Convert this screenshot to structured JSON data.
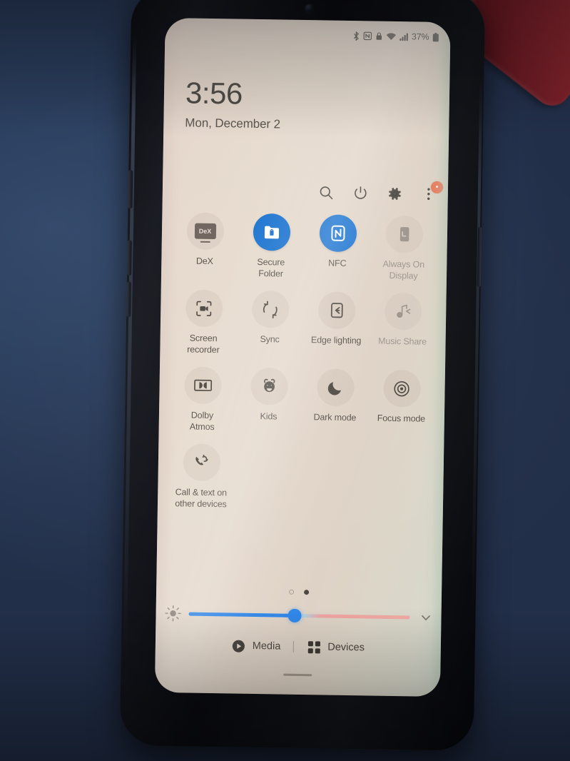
{
  "photo": {
    "background_color": "#22304a",
    "red_object_color": "#7c2028",
    "phone_body_color": "#0c0d12"
  },
  "screen": {
    "background_color": "#e3d4c9",
    "accent_color": "#1a73d0",
    "slider_color": "#2d85e8",
    "badge_color": "#ec6a4a"
  },
  "status_bar": {
    "icons": [
      {
        "name": "bluetooth-icon",
        "glyph": "✶"
      },
      {
        "name": "nfc-icon",
        "glyph": "N"
      },
      {
        "name": "lock-icon",
        "glyph": "▣"
      },
      {
        "name": "wifi-icon",
        "glyph": "◠"
      },
      {
        "name": "signal-icon",
        "glyph": "▂"
      }
    ],
    "battery_percent": "37%"
  },
  "clock": {
    "time": "3:56",
    "date": "Mon, December 2"
  },
  "header_actions": [
    {
      "name": "search-icon",
      "label": "Search"
    },
    {
      "name": "power-icon",
      "label": "Power off"
    },
    {
      "name": "gear-icon",
      "label": "Settings"
    },
    {
      "name": "more-options-icon",
      "label": "More options",
      "badge": "•"
    }
  ],
  "tiles": [
    {
      "id": "dex",
      "label": "DeX",
      "icon": "dex-icon",
      "state": "off",
      "badge_text": "DeX"
    },
    {
      "id": "secure-folder",
      "label": "Secure\nFolder",
      "icon": "secure-folder-icon",
      "state": "on"
    },
    {
      "id": "nfc",
      "label": "NFC",
      "icon": "nfc-icon",
      "state": "on"
    },
    {
      "id": "always-on-display",
      "label": "Always On\nDisplay",
      "icon": "always-on-display-icon",
      "state": "disabled"
    },
    {
      "id": "screen-recorder",
      "label": "Screen\nrecorder",
      "icon": "screen-recorder-icon",
      "state": "off"
    },
    {
      "id": "sync",
      "label": "Sync",
      "icon": "sync-icon",
      "state": "off"
    },
    {
      "id": "edge-lighting",
      "label": "Edge lighting",
      "icon": "edge-lighting-icon",
      "state": "off"
    },
    {
      "id": "music-share",
      "label": "Music Share",
      "icon": "music-share-icon",
      "state": "disabled"
    },
    {
      "id": "dolby-atmos",
      "label": "Dolby\nAtmos",
      "icon": "dolby-atmos-icon",
      "state": "off"
    },
    {
      "id": "kids",
      "label": "Kids",
      "icon": "kids-icon",
      "state": "off"
    },
    {
      "id": "dark-mode",
      "label": "Dark mode",
      "icon": "dark-mode-icon",
      "state": "off"
    },
    {
      "id": "focus-mode",
      "label": "Focus mode",
      "icon": "focus-mode-icon",
      "state": "off"
    },
    {
      "id": "call-text-other-devices",
      "label": "Call & text on\nother devices",
      "icon": "call-sync-icon",
      "state": "off"
    }
  ],
  "page_indicator": {
    "total": 2,
    "active_index": 1
  },
  "brightness": {
    "icon": "brightness-icon",
    "value_percent": 48,
    "expand_icon": "chevron-down-icon"
  },
  "bottom_bar": {
    "media": {
      "label": "Media",
      "icon": "play-circle-icon"
    },
    "divider": "|",
    "devices": {
      "label": "Devices",
      "icon": "grid-dots-icon"
    }
  }
}
